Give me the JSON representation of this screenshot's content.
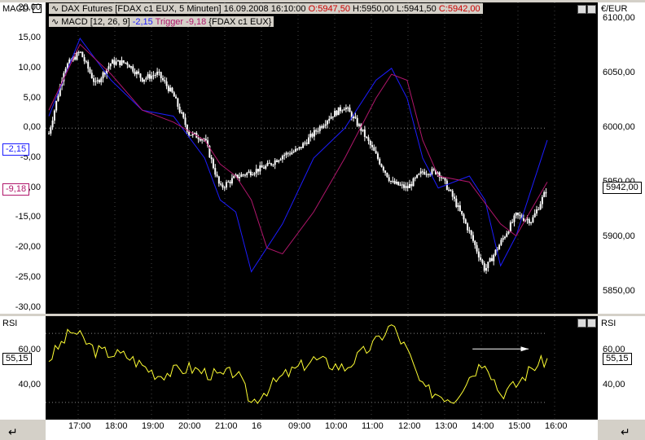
{
  "header": {
    "macd_axis_title": "MACD",
    "currency_title": "€/EUR",
    "instrument": "DAX Futures [FDAX c1 EUX, 5 Minuten]",
    "datetime": "16.09.2008 16:10:00",
    "open": "O:5947,50",
    "high": "H:5950,00",
    "low": "L:5941,50",
    "close": "C:5942,00",
    "macd_label": "MACD [12, 26, 9]",
    "macd_value": "-2,15",
    "trigger_label": "Trigger",
    "trigger_value": "-9,18",
    "macd_symbol": "{FDAX c1 EUX}"
  },
  "rsi": {
    "title_left": "RSI",
    "title_right": "RSI",
    "value_left": "55,15",
    "value_right": "55,15"
  },
  "markers": {
    "macd_value": "-2,15",
    "trigger_value": "-9,18",
    "price_value": "5942,00"
  },
  "colors": {
    "price": "#ffffff",
    "macd": "#1c1cff",
    "trigger": "#b0166b",
    "rsi": "#ffff33",
    "ok": "#ff0000"
  },
  "chart_data": [
    {
      "type": "candlestick",
      "title": "DAX Futures [FDAX c1 EUX, 5 Minuten]",
      "y_axis_side": "right",
      "ylabel": "€/EUR",
      "ylim": [
        5830,
        6115
      ],
      "y_ticks": [
        "6100,00",
        "6050,00",
        "6000,00",
        "5950,00",
        "5900,00",
        "5850,00"
      ],
      "x_ticks": [
        "17:00",
        "18:00",
        "19:00",
        "20:00",
        "21:00",
        "16",
        "09:00",
        "10:00",
        "11:00",
        "12:00",
        "13:00",
        "14:00",
        "15:00",
        "16:00"
      ],
      "last_price": 5942.0,
      "price_points": [
        [
          0,
          5995
        ],
        [
          10,
          6055
        ],
        [
          20,
          6070
        ],
        [
          30,
          6040
        ],
        [
          40,
          6060
        ],
        [
          50,
          6060
        ],
        [
          60,
          6045
        ],
        [
          70,
          6050
        ],
        [
          80,
          6030
        ],
        [
          90,
          5995
        ],
        [
          100,
          5990
        ],
        [
          110,
          5945
        ],
        [
          120,
          5955
        ],
        [
          130,
          5960
        ],
        [
          140,
          5965
        ],
        [
          150,
          5975
        ],
        [
          160,
          5980
        ],
        [
          170,
          5995
        ],
        [
          180,
          6010
        ],
        [
          190,
          6020
        ],
        [
          200,
          6000
        ],
        [
          210,
          5975
        ],
        [
          220,
          5950
        ],
        [
          230,
          5945
        ],
        [
          240,
          5960
        ],
        [
          250,
          5960
        ],
        [
          260,
          5935
        ],
        [
          270,
          5905
        ],
        [
          280,
          5870
        ],
        [
          290,
          5895
        ],
        [
          300,
          5920
        ],
        [
          310,
          5915
        ],
        [
          320,
          5945
        ]
      ]
    },
    {
      "type": "line",
      "title": "MACD [12, 26, 9]",
      "y_axis_side": "left",
      "ylabel": "MACD",
      "ylim": [
        -31,
        21
      ],
      "y_ticks": [
        "20,00",
        "15,00",
        "10,00",
        "5,00",
        "0,00",
        "-5,00",
        "-10,00",
        "-15,00",
        "-20,00",
        "-25,00",
        "-30,00"
      ],
      "series": [
        {
          "name": "MACD",
          "values": [
            [
              0,
              2
            ],
            [
              20,
              15
            ],
            [
              40,
              8
            ],
            [
              60,
              3
            ],
            [
              80,
              2
            ],
            [
              100,
              -5
            ],
            [
              110,
              -12
            ],
            [
              120,
              -14
            ],
            [
              130,
              -24
            ],
            [
              150,
              -16
            ],
            [
              170,
              -5
            ],
            [
              190,
              0
            ],
            [
              210,
              8
            ],
            [
              220,
              10
            ],
            [
              230,
              5
            ],
            [
              240,
              -5
            ],
            [
              250,
              -10
            ],
            [
              270,
              -8
            ],
            [
              280,
              -12
            ],
            [
              290,
              -23
            ],
            [
              300,
              -18
            ],
            [
              320,
              -2
            ]
          ]
        },
        {
          "name": "Trigger",
          "values": [
            [
              0,
              3
            ],
            [
              20,
              14
            ],
            [
              40,
              9
            ],
            [
              60,
              3
            ],
            [
              80,
              1
            ],
            [
              100,
              -2
            ],
            [
              110,
              -6
            ],
            [
              120,
              -8
            ],
            [
              130,
              -12
            ],
            [
              140,
              -20
            ],
            [
              150,
              -21
            ],
            [
              170,
              -14
            ],
            [
              190,
              -5
            ],
            [
              210,
              5
            ],
            [
              220,
              9
            ],
            [
              230,
              8
            ],
            [
              240,
              -2
            ],
            [
              250,
              -8
            ],
            [
              270,
              -9
            ],
            [
              290,
              -16
            ],
            [
              300,
              -18
            ],
            [
              320,
              -9
            ]
          ]
        }
      ]
    },
    {
      "type": "line",
      "title": "RSI",
      "ylim": [
        20,
        80
      ],
      "y_ticks": [
        "60,00",
        "40,00"
      ],
      "series": [
        {
          "name": "RSI",
          "values": [
            [
              0,
              55
            ],
            [
              15,
              72
            ],
            [
              30,
              60
            ],
            [
              50,
              57
            ],
            [
              70,
              46
            ],
            [
              90,
              50
            ],
            [
              110,
              45
            ],
            [
              120,
              48
            ],
            [
              130,
              30
            ],
            [
              150,
              45
            ],
            [
              170,
              55
            ],
            [
              190,
              50
            ],
            [
              210,
              65
            ],
            [
              220,
              75
            ],
            [
              230,
              60
            ],
            [
              240,
              38
            ],
            [
              260,
              32
            ],
            [
              270,
              45
            ],
            [
              280,
              55
            ],
            [
              290,
              35
            ],
            [
              300,
              40
            ],
            [
              310,
              50
            ],
            [
              320,
              55
            ]
          ]
        }
      ]
    }
  ]
}
